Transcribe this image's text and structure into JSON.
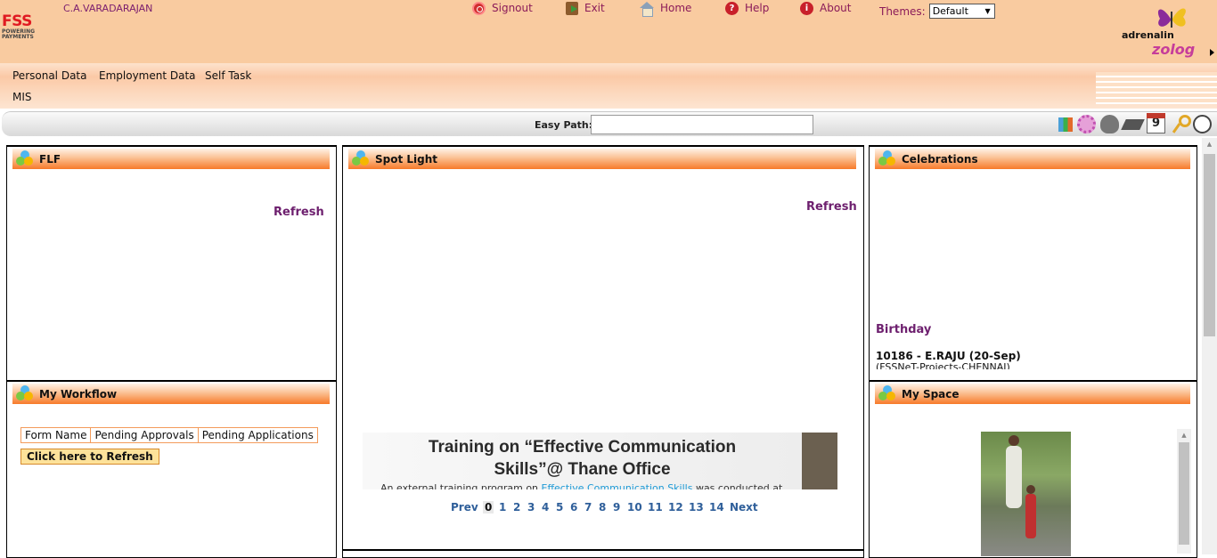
{
  "header": {
    "logo": "FSS",
    "logo_tagline": "POWERING PAYMENTS",
    "username": "C.A.VARADARAJAN",
    "nav": {
      "signout": "Signout",
      "exit": "Exit",
      "home": "Home",
      "help": "Help",
      "about": "About"
    },
    "themes_label": "Themes:",
    "theme_selected": "Default",
    "brand_text": "adrenalin",
    "brand_product": "zolog"
  },
  "menu": {
    "items": [
      "Personal Data",
      "Employment Data",
      "Self Task",
      "MIS"
    ]
  },
  "easy_path": {
    "label": "Easy Path:",
    "value": ""
  },
  "panels": {
    "flf": {
      "title": "FLF",
      "refresh": "Refresh"
    },
    "spotlight": {
      "title": "Spot Light",
      "refresh": "Refresh",
      "banner_title_1": "Training on “Effective Communication",
      "banner_title_2": "Skills”@ Thane Office",
      "banner_text_pre": "An external training program on ",
      "banner_text_link": "Effective Communication Skills",
      "banner_text_post": " was conducted at",
      "pager": {
        "prev": "Prev",
        "pages": [
          "0",
          "1",
          "2",
          "3",
          "4",
          "5",
          "6",
          "7",
          "8",
          "9",
          "10",
          "11",
          "12",
          "13",
          "14"
        ],
        "active": "0",
        "next": "Next"
      }
    },
    "celebrations": {
      "title": "Celebrations",
      "section": "Birthday",
      "entry": "10186 - E.RAJU (20-Sep)",
      "entry_sub": "(FSSNeT-Projects-CHENNAI)"
    },
    "workflow": {
      "title": "My Workflow",
      "columns": [
        "Form Name",
        "Pending Approvals",
        "Pending Applications"
      ],
      "refresh_button": "Click here to Refresh"
    },
    "myspace": {
      "title": "My Space"
    }
  }
}
